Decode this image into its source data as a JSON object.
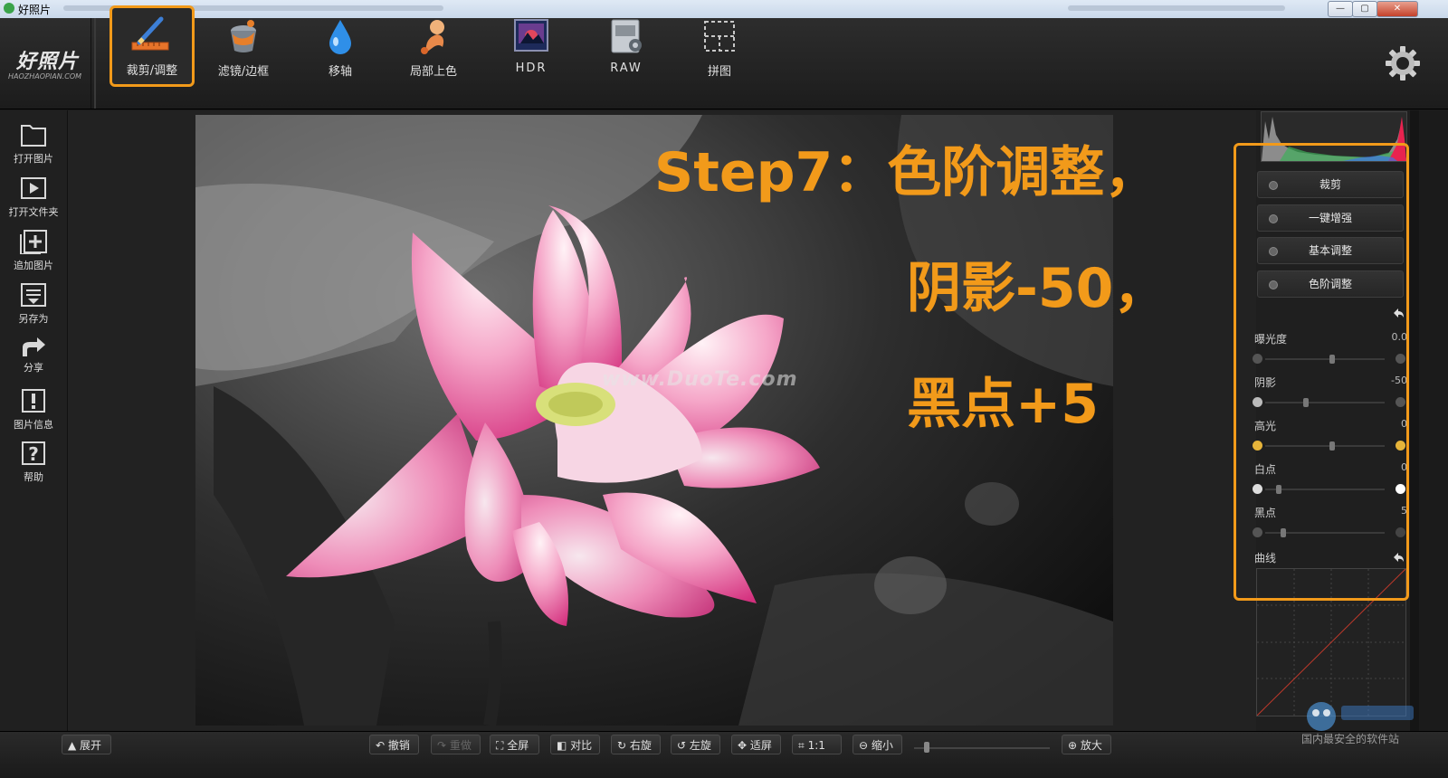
{
  "window": {
    "title": "好照片",
    "minimize": "—",
    "maximize": "▢",
    "close": "✕"
  },
  "logo": {
    "main": "好照片",
    "sub": "HAOZHAOPIAN.COM"
  },
  "tools": [
    {
      "label": "裁剪/调整"
    },
    {
      "label": "滤镜/边框"
    },
    {
      "label": "移轴"
    },
    {
      "label": "局部上色"
    },
    {
      "label": "HDR"
    },
    {
      "label": "RAW"
    },
    {
      "label": "拼图"
    }
  ],
  "sidebar": [
    {
      "label": "打开图片"
    },
    {
      "label": "打开文件夹"
    },
    {
      "label": "追加图片"
    },
    {
      "label": "另存为"
    },
    {
      "label": "分享"
    },
    {
      "label": "图片信息"
    },
    {
      "label": "帮助"
    }
  ],
  "annotation": {
    "line1": "Step7：色阶调整，",
    "line2": "阴影-50，",
    "line3": "黑点+5"
  },
  "watermark": "www.DuoTe.com",
  "panel": {
    "buttons": [
      "裁剪",
      "一键增强",
      "基本调整",
      "色阶调整"
    ],
    "sliders": [
      {
        "label": "曝光度",
        "value": "0.0",
        "level": 0.5
      },
      {
        "label": "阴影",
        "value": "-50",
        "level": 0.25
      },
      {
        "label": "高光",
        "value": "0",
        "level": 0.5
      },
      {
        "label": "白点",
        "value": "0",
        "level": 0.0
      },
      {
        "label": "黑点",
        "value": "5",
        "level": 0.04
      }
    ],
    "curve_label": "曲线"
  },
  "bottom": {
    "expand": "展开",
    "undo": "撤销",
    "redo": "重做",
    "fullscreen": "全屏",
    "compare": "对比",
    "rotate_right": "右旋",
    "rotate_left": "左旋",
    "fit": "适屏",
    "actual": "1:1",
    "zoom_out": "缩小",
    "zoom_in": "放大"
  },
  "corner_text": "国内最安全的软件站"
}
